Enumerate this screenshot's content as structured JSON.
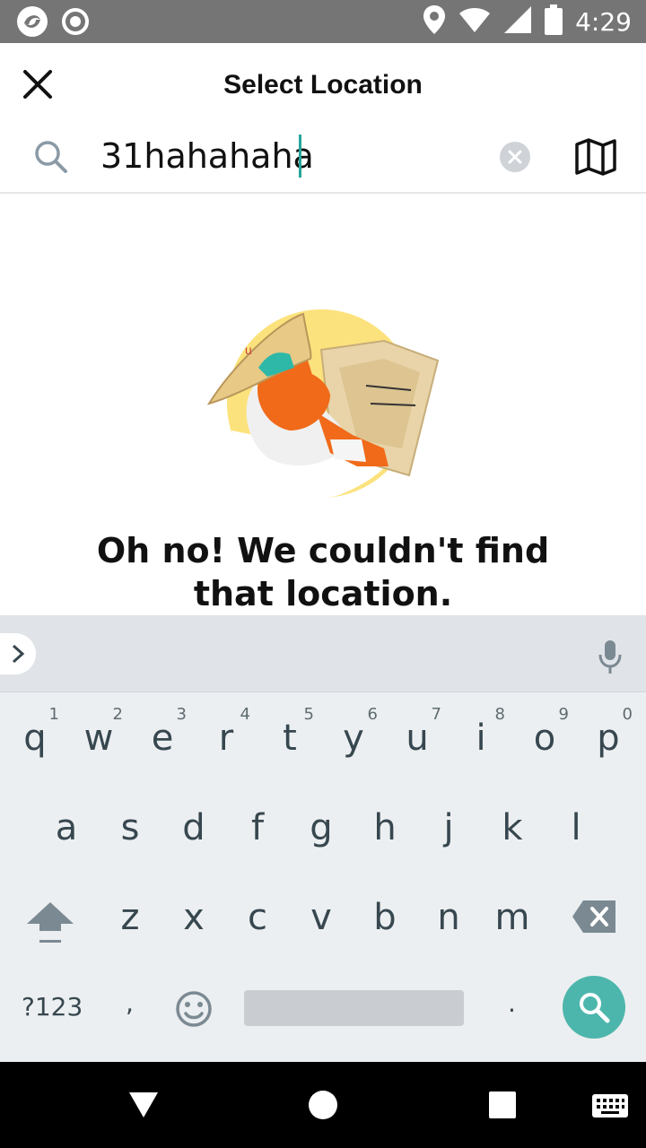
{
  "status_bar": {
    "time": "4:29",
    "icons": [
      "app-icon",
      "record-icon",
      "location-icon",
      "wifi-icon",
      "signal-icon",
      "battery-icon"
    ]
  },
  "header": {
    "title": "Select Location",
    "close_icon": "close-icon"
  },
  "search": {
    "value": "31hahahaha",
    "search_icon": "search-icon",
    "clear_icon": "clear-icon",
    "map_icon": "map-icon"
  },
  "empty_state": {
    "message": "Oh no! We couldn't find that location.",
    "illustration": "cat-with-map-illustration"
  },
  "keyboard": {
    "row1": [
      {
        "ch": "q",
        "num": "1"
      },
      {
        "ch": "w",
        "num": "2"
      },
      {
        "ch": "e",
        "num": "3"
      },
      {
        "ch": "r",
        "num": "4"
      },
      {
        "ch": "t",
        "num": "5"
      },
      {
        "ch": "y",
        "num": "6"
      },
      {
        "ch": "u",
        "num": "7"
      },
      {
        "ch": "i",
        "num": "8"
      },
      {
        "ch": "o",
        "num": "9"
      },
      {
        "ch": "p",
        "num": "0"
      }
    ],
    "row2": [
      "a",
      "s",
      "d",
      "f",
      "g",
      "h",
      "j",
      "k",
      "l"
    ],
    "row3": [
      "z",
      "x",
      "c",
      "v",
      "b",
      "n",
      "m"
    ],
    "symbols_label": "?123",
    "comma": ",",
    "period": "."
  },
  "colors": {
    "status_bar": "#757575",
    "accent": "#4db6ac",
    "caret": "#27a59a",
    "keyboard_bg": "#eceff1"
  }
}
